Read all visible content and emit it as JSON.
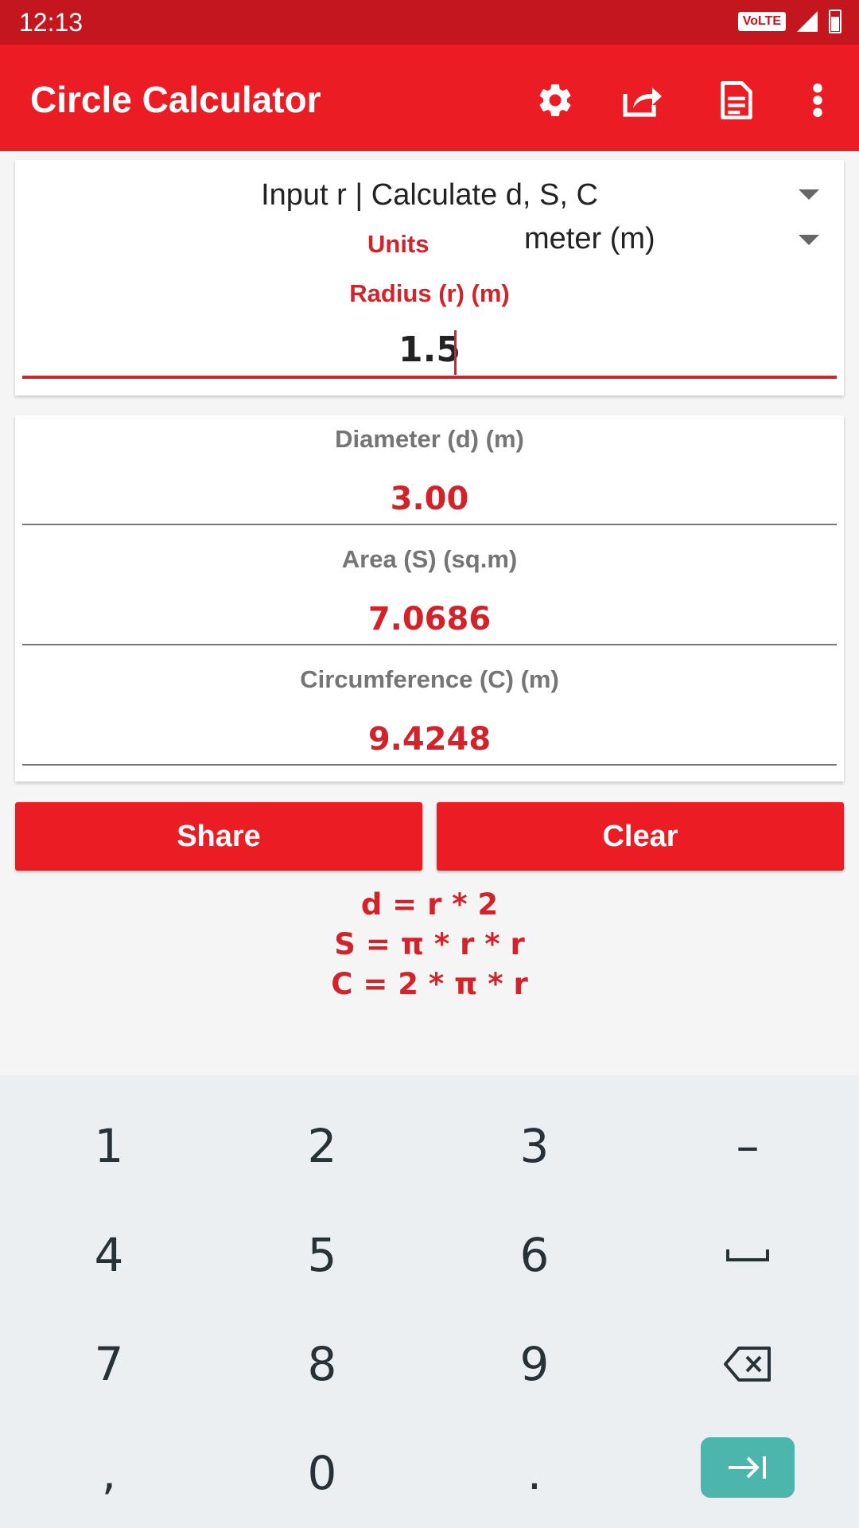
{
  "status_bar": {
    "time": "12:13",
    "network_badge": "VoLTE"
  },
  "app_bar": {
    "title": "Circle Calculator",
    "actions": [
      "gear-icon",
      "share-icon",
      "document-icon",
      "more-vert-icon"
    ]
  },
  "input_card": {
    "mode": "Input r | Calculate d, S, C",
    "units_label": "Units",
    "units_value": "meter (m)",
    "radius_label": "Radius (r) (m)",
    "radius_value": "1.5"
  },
  "results": [
    {
      "label": "Diameter (d) (m)",
      "value": "3.00"
    },
    {
      "label": "Area (S) (sq.m)",
      "value": "7.0686"
    },
    {
      "label": "Circumference (C) (m)",
      "value": "9.4248"
    }
  ],
  "buttons": {
    "share": "Share",
    "clear": "Clear"
  },
  "formulas": [
    "d = r * 2",
    "S = π * r * r",
    "C = 2 * π * r"
  ],
  "keyboard": {
    "keys": [
      "1",
      "2",
      "3",
      "–",
      "4",
      "5",
      "6",
      "␣",
      "7",
      "8",
      "9",
      "backspace",
      ",",
      "0",
      ".",
      "next"
    ]
  },
  "colors": {
    "status_bar": "#c4161f",
    "app_bar": "#ec1c24",
    "accent": "#d2232a",
    "keyboard_go": "#4db6ac"
  }
}
